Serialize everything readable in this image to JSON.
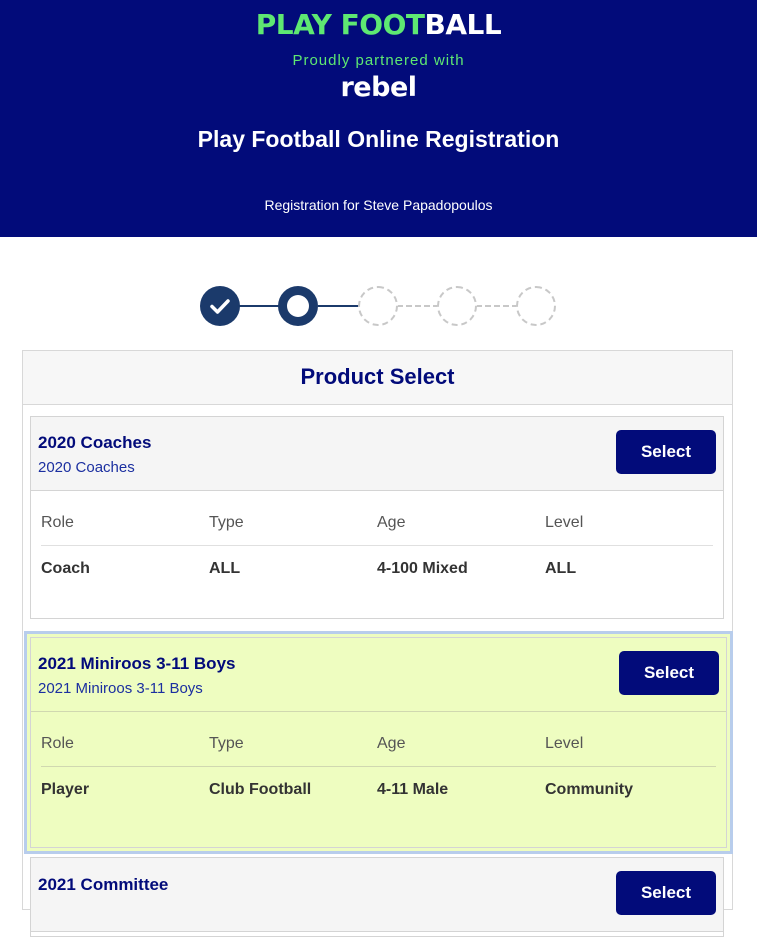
{
  "header": {
    "logo_part1": "PLAY FOOT",
    "logo_part2": "BALL",
    "partner": "Proudly partnered with",
    "partner_brand": "rebel",
    "title": "Play Football Online Registration",
    "registration_for": "Registration for Steve Papadopoulos"
  },
  "stepper": {
    "total_steps": 5,
    "completed": 1,
    "current": 2
  },
  "panel": {
    "title": "Product Select"
  },
  "products": [
    {
      "title": "2020 Coaches",
      "subtitle": "2020 Coaches",
      "select_label": "Select",
      "headers": [
        "Role",
        "Type",
        "Age",
        "Level"
      ],
      "values": [
        "Coach",
        "ALL",
        "4-100 Mixed",
        "ALL"
      ]
    },
    {
      "title": "2021 Miniroos 3-11 Boys",
      "subtitle": "2021 Miniroos 3-11 Boys",
      "select_label": "Select",
      "headers": [
        "Role",
        "Type",
        "Age",
        "Level"
      ],
      "values": [
        "Player",
        "Club Football",
        "4-11 Male",
        "Community"
      ]
    },
    {
      "title": "2021 Committee",
      "select_label": "Select"
    }
  ],
  "colors": {
    "header_bg": "#020b7a",
    "accent_green": "#5ee872",
    "step_done": "#1b3a6b",
    "selected_bg": "#eefdc0",
    "selected_border": "#b8cdec"
  },
  "icons": {
    "step_done": "check-icon"
  }
}
